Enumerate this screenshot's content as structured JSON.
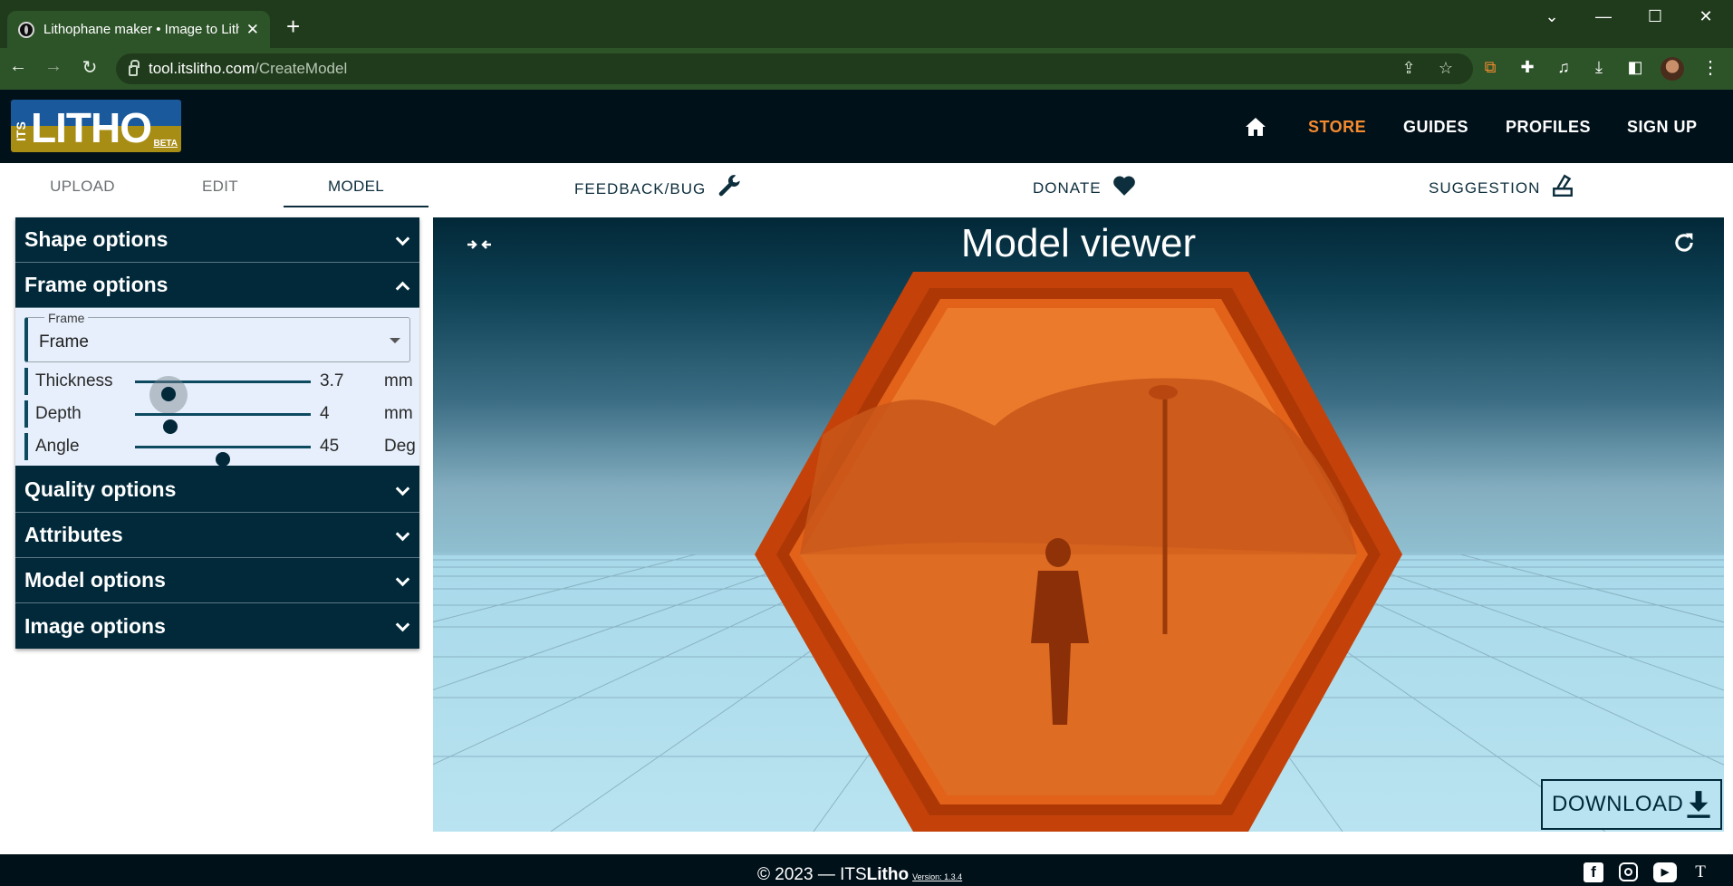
{
  "browser": {
    "tab_title": "Lithophane maker • Image to Lith",
    "new_tab": "+",
    "url_host": "tool.itslitho.com",
    "url_path": "/CreateModel"
  },
  "site": {
    "logo": {
      "its": "ITS",
      "word": "LITHO",
      "beta": "BETA"
    },
    "nav": [
      "STORE",
      "GUIDES",
      "PROFILES",
      "SIGN UP"
    ]
  },
  "subtabs": [
    "UPLOAD",
    "EDIT",
    "MODEL"
  ],
  "links": {
    "feedback": "FEEDBACK/BUG",
    "donate": "DONATE",
    "suggestion": "SUGGESTION"
  },
  "sidebar": {
    "shape": "Shape options",
    "frame": "Frame options",
    "frame_select_label": "Frame",
    "frame_select_value": "Frame",
    "sliders": [
      {
        "label": "Thickness",
        "value": "3.7",
        "unit": "mm",
        "position": 0.19
      },
      {
        "label": "Depth",
        "value": "4",
        "unit": "mm",
        "position": 0.2
      },
      {
        "label": "Angle",
        "value": "45",
        "unit": "Deg",
        "position": 0.5
      }
    ],
    "quality": "Quality options",
    "attributes": "Attributes",
    "model": "Model options",
    "image": "Image options"
  },
  "viewer": {
    "title": "Model viewer",
    "download": "DOWNLOAD"
  },
  "footer": {
    "copyright_prefix": "© 2023 — ITS",
    "copyright_brand": "Litho",
    "version": "Version: 1.3.4"
  },
  "colors": {
    "accent": "#f58a2f",
    "header_bg": "#01111a",
    "panel_bg": "#01293a",
    "model_orange": "#e05a12"
  }
}
